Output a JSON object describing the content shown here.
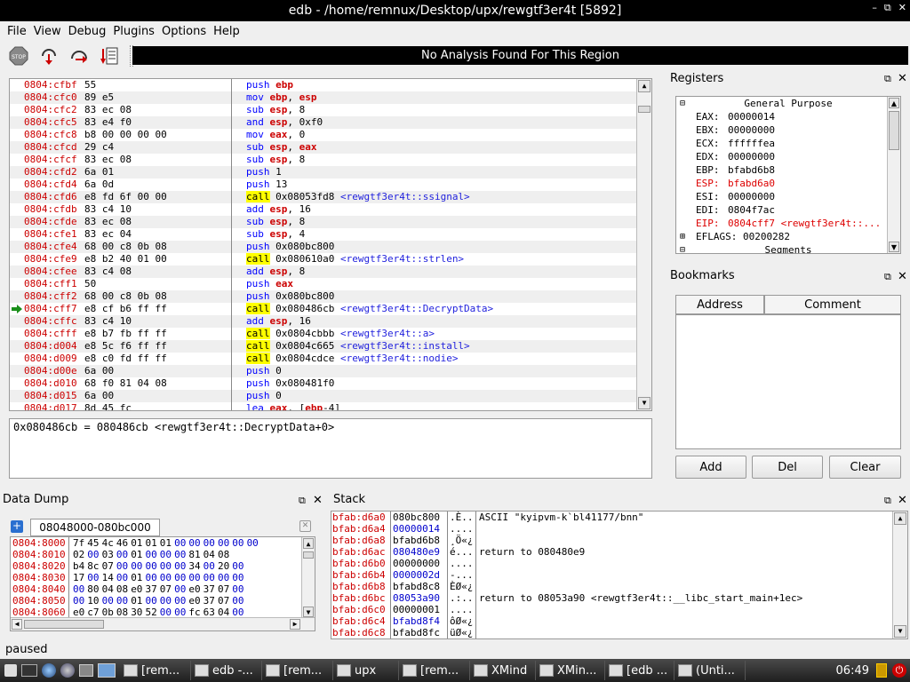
{
  "window": {
    "title": "edb - /home/remnux/Desktop/upx/rewgtf3er4t [5892]",
    "controls": [
      "–",
      "⧉",
      "✕"
    ]
  },
  "menu": [
    "File",
    "View",
    "Debug",
    "Plugins",
    "Options",
    "Help"
  ],
  "analysis_banner": "No Analysis Found For This Region",
  "disasm": [
    {
      "addr": "0804:cfbf",
      "bytes": "55",
      "ins": [
        [
          "m",
          "push "
        ],
        [
          "r",
          "ebp"
        ]
      ]
    },
    {
      "addr": "0804:cfc0",
      "bytes": "89 e5",
      "ins": [
        [
          "m",
          "mov "
        ],
        [
          "r",
          "ebp"
        ],
        [
          "t",
          ", "
        ],
        [
          "r",
          "esp"
        ]
      ]
    },
    {
      "addr": "0804:cfc2",
      "bytes": "83 ec 08",
      "ins": [
        [
          "m",
          "sub "
        ],
        [
          "r",
          "esp"
        ],
        [
          "t",
          ", 8"
        ]
      ]
    },
    {
      "addr": "0804:cfc5",
      "bytes": "83 e4 f0",
      "ins": [
        [
          "m",
          "and "
        ],
        [
          "r",
          "esp"
        ],
        [
          "t",
          ", 0xf0"
        ]
      ]
    },
    {
      "addr": "0804:cfc8",
      "bytes": "b8 00 00 00 00",
      "ins": [
        [
          "m",
          "mov "
        ],
        [
          "r",
          "eax"
        ],
        [
          "t",
          ", 0"
        ]
      ]
    },
    {
      "addr": "0804:cfcd",
      "bytes": "29 c4",
      "ins": [
        [
          "m",
          "sub "
        ],
        [
          "r",
          "esp"
        ],
        [
          "t",
          ", "
        ],
        [
          "r",
          "eax"
        ]
      ]
    },
    {
      "addr": "0804:cfcf",
      "bytes": "83 ec 08",
      "ins": [
        [
          "m",
          "sub "
        ],
        [
          "r",
          "esp"
        ],
        [
          "t",
          ", 8"
        ]
      ]
    },
    {
      "addr": "0804:cfd2",
      "bytes": "6a 01",
      "ins": [
        [
          "m",
          "push "
        ],
        [
          "t",
          "1"
        ]
      ]
    },
    {
      "addr": "0804:cfd4",
      "bytes": "6a 0d",
      "ins": [
        [
          "m",
          "push "
        ],
        [
          "t",
          "13"
        ]
      ]
    },
    {
      "addr": "0804:cfd6",
      "bytes": "e8 fd 6f 00 00",
      "ins": [
        [
          "c",
          "call"
        ],
        [
          "t",
          " 0x08053fd8 "
        ],
        [
          "s",
          "<rewgtf3er4t::ssignal>"
        ]
      ]
    },
    {
      "addr": "0804:cfdb",
      "bytes": "83 c4 10",
      "ins": [
        [
          "m",
          "add "
        ],
        [
          "r",
          "esp"
        ],
        [
          "t",
          ", 16"
        ]
      ]
    },
    {
      "addr": "0804:cfde",
      "bytes": "83 ec 08",
      "ins": [
        [
          "m",
          "sub "
        ],
        [
          "r",
          "esp"
        ],
        [
          "t",
          ", 8"
        ]
      ]
    },
    {
      "addr": "0804:cfe1",
      "bytes": "83 ec 04",
      "ins": [
        [
          "m",
          "sub "
        ],
        [
          "r",
          "esp"
        ],
        [
          "t",
          ", 4"
        ]
      ]
    },
    {
      "addr": "0804:cfe4",
      "bytes": "68 00 c8 0b 08",
      "ins": [
        [
          "m",
          "push "
        ],
        [
          "t",
          "0x080bc800"
        ]
      ]
    },
    {
      "addr": "0804:cfe9",
      "bytes": "e8 b2 40 01 00",
      "ins": [
        [
          "c",
          "call"
        ],
        [
          "t",
          " 0x080610a0 "
        ],
        [
          "s",
          "<rewgtf3er4t::strlen>"
        ]
      ]
    },
    {
      "addr": "0804:cfee",
      "bytes": "83 c4 08",
      "ins": [
        [
          "m",
          "add "
        ],
        [
          "r",
          "esp"
        ],
        [
          "t",
          ", 8"
        ]
      ]
    },
    {
      "addr": "0804:cff1",
      "bytes": "50",
      "ins": [
        [
          "m",
          "push "
        ],
        [
          "r",
          "eax"
        ]
      ]
    },
    {
      "addr": "0804:cff2",
      "bytes": "68 00 c8 0b 08",
      "ins": [
        [
          "m",
          "push "
        ],
        [
          "t",
          "0x080bc800"
        ]
      ]
    },
    {
      "addr": "0804:cff7",
      "bytes": "e8 cf b6 ff ff",
      "ins": [
        [
          "c",
          "call"
        ],
        [
          "t",
          " 0x080486cb "
        ],
        [
          "s",
          "<rewgtf3er4t::DecryptData>"
        ]
      ],
      "current": true
    },
    {
      "addr": "0804:cffc",
      "bytes": "83 c4 10",
      "ins": [
        [
          "m",
          "add "
        ],
        [
          "r",
          "esp"
        ],
        [
          "t",
          ", 16"
        ]
      ]
    },
    {
      "addr": "0804:cfff",
      "bytes": "e8 b7 fb ff ff",
      "ins": [
        [
          "c",
          "call"
        ],
        [
          "t",
          " 0x0804cbbb "
        ],
        [
          "s",
          "<rewgtf3er4t::a>"
        ]
      ]
    },
    {
      "addr": "0804:d004",
      "bytes": "e8 5c f6 ff ff",
      "ins": [
        [
          "c",
          "call"
        ],
        [
          "t",
          " 0x0804c665 "
        ],
        [
          "s",
          "<rewgtf3er4t::install>"
        ]
      ]
    },
    {
      "addr": "0804:d009",
      "bytes": "e8 c0 fd ff ff",
      "ins": [
        [
          "c",
          "call"
        ],
        [
          "t",
          " 0x0804cdce "
        ],
        [
          "s",
          "<rewgtf3er4t::nodie>"
        ]
      ]
    },
    {
      "addr": "0804:d00e",
      "bytes": "6a 00",
      "ins": [
        [
          "m",
          "push "
        ],
        [
          "t",
          "0"
        ]
      ]
    },
    {
      "addr": "0804:d010",
      "bytes": "68 f0 81 04 08",
      "ins": [
        [
          "m",
          "push "
        ],
        [
          "t",
          "0x080481f0"
        ]
      ]
    },
    {
      "addr": "0804:d015",
      "bytes": "6a 00",
      "ins": [
        [
          "m",
          "push "
        ],
        [
          "t",
          "0"
        ]
      ]
    },
    {
      "addr": "0804:d017",
      "bytes": "8d 45 fc",
      "ins": [
        [
          "m",
          "lea "
        ],
        [
          "r",
          "eax"
        ],
        [
          "t",
          ", ["
        ],
        [
          "r",
          "ebp"
        ],
        [
          "t",
          "-4]"
        ]
      ]
    }
  ],
  "info_line": "0x080486cb = 080486cb <rewgtf3er4t::DecryptData+0>",
  "registers": {
    "title": "Registers",
    "group": "General Purpose",
    "rows": [
      {
        "name": "EAX:",
        "val": "00000014",
        "changed": false
      },
      {
        "name": "EBX:",
        "val": "00000000",
        "changed": false
      },
      {
        "name": "ECX:",
        "val": "ffffffea",
        "changed": false
      },
      {
        "name": "EDX:",
        "val": "00000000",
        "changed": false
      },
      {
        "name": "EBP:",
        "val": "bfabd6b8",
        "changed": false
      },
      {
        "name": "ESP:",
        "val": "bfabd6a0",
        "changed": true
      },
      {
        "name": "ESI:",
        "val": "00000000",
        "changed": false
      },
      {
        "name": "EDI:",
        "val": "0804f7ac",
        "changed": false
      },
      {
        "name": "EIP:",
        "val": "0804cff7 <rewgtf3er4t::...",
        "changed": true
      }
    ],
    "eflags": "EFLAGS: 00200282",
    "segments": "Segments"
  },
  "bookmarks": {
    "title": "Bookmarks",
    "col_address": "Address",
    "col_comment": "Comment",
    "add": "Add",
    "del": "Del",
    "clear": "Clear"
  },
  "datadump": {
    "title": "Data Dump",
    "tab": "08048000-080bc000",
    "rows": [
      {
        "addr": "0804:8000",
        "bytes": [
          "7f",
          "45",
          "4c",
          "46",
          "01",
          "01",
          "01",
          "00",
          "00",
          "00",
          "00",
          "00",
          "00"
        ]
      },
      {
        "addr": "0804:8010",
        "bytes": [
          "02",
          "00",
          "03",
          "00",
          "01",
          "00",
          "00",
          "00",
          "81",
          "04",
          "08",
          ""
        ]
      },
      {
        "addr": "0804:8020",
        "bytes": [
          "b4",
          "8c",
          "07",
          "00",
          "00",
          "00",
          "00",
          "00",
          "34",
          "00",
          "20",
          "00"
        ]
      },
      {
        "addr": "0804:8030",
        "bytes": [
          "17",
          "00",
          "14",
          "00",
          "01",
          "00",
          "00",
          "00",
          "00",
          "00",
          "00",
          "00"
        ]
      },
      {
        "addr": "0804:8040",
        "bytes": [
          "00",
          "80",
          "04",
          "08",
          "e0",
          "37",
          "07",
          "00",
          "e0",
          "37",
          "07",
          "00"
        ]
      },
      {
        "addr": "0804:8050",
        "bytes": [
          "00",
          "10",
          "00",
          "00",
          "01",
          "00",
          "00",
          "00",
          "e0",
          "37",
          "07",
          "00"
        ]
      },
      {
        "addr": "0804:8060",
        "bytes": [
          "e0",
          "c7",
          "0b",
          "08",
          "30",
          "52",
          "00",
          "00",
          "fc",
          "63",
          "04",
          "00"
        ]
      }
    ]
  },
  "stack": {
    "title": "Stack",
    "rows": [
      {
        "addr": "bfab:d6a0",
        "val": "080bc800",
        "ascii": ".È..",
        "cmt": "ASCII \"kyipvm-k`bl41177/bnn\"",
        "blue": false
      },
      {
        "addr": "bfab:d6a4",
        "val": "00000014",
        "ascii": "....",
        "cmt": "",
        "blue": true
      },
      {
        "addr": "bfab:d6a8",
        "val": "bfabd6b8",
        "ascii": "¸Ö«¿",
        "cmt": "",
        "blue": false
      },
      {
        "addr": "bfab:d6ac",
        "val": "080480e9",
        "ascii": "é...",
        "cmt": "return to 080480e9",
        "blue": true
      },
      {
        "addr": "bfab:d6b0",
        "val": "00000000",
        "ascii": "....",
        "cmt": "",
        "blue": false
      },
      {
        "addr": "bfab:d6b4",
        "val": "0000002d",
        "ascii": "-...",
        "cmt": "",
        "blue": true
      },
      {
        "addr": "bfab:d6b8",
        "val": "bfabd8c8",
        "ascii": "ÈØ«¿",
        "cmt": "",
        "blue": false
      },
      {
        "addr": "bfab:d6bc",
        "val": "08053a90",
        "ascii": ".:..",
        "cmt": "return to 08053a90 <rewgtf3er4t::__libc_start_main+1ec>",
        "blue": true
      },
      {
        "addr": "bfab:d6c0",
        "val": "00000001",
        "ascii": "....",
        "cmt": "",
        "blue": false
      },
      {
        "addr": "bfab:d6c4",
        "val": "bfabd8f4",
        "ascii": "ôØ«¿",
        "cmt": "",
        "blue": true
      },
      {
        "addr": "bfab:d6c8",
        "val": "bfabd8fc",
        "ascii": "üØ«¿",
        "cmt": "",
        "blue": false
      }
    ]
  },
  "status": "paused",
  "taskbar": {
    "items": [
      "[rem...",
      "edb -...",
      "[rem...",
      "upx",
      "[rem...",
      "XMind",
      "XMin...",
      "[edb ...",
      "(Unti..."
    ],
    "clock": "06:49"
  }
}
